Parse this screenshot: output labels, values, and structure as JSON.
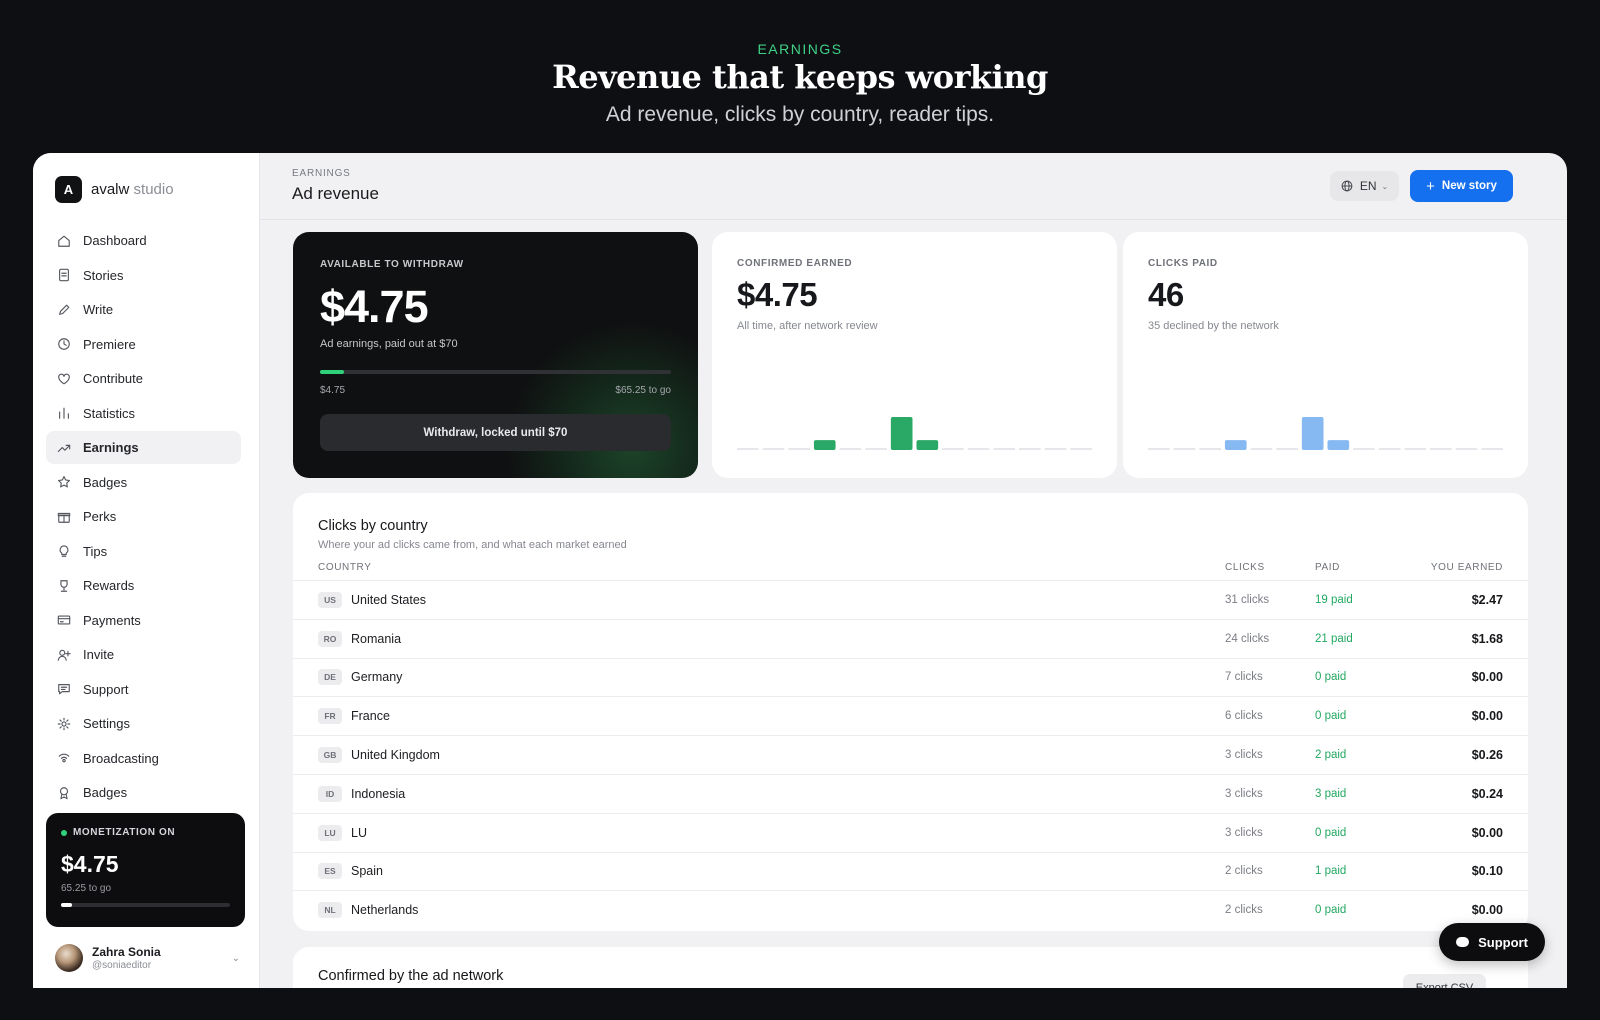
{
  "hero": {
    "kicker": "EARNINGS",
    "title": "Revenue that keeps working",
    "subtitle": "Ad revenue, clicks by country, reader tips."
  },
  "brand": {
    "mark": "A",
    "name": "avalw",
    "suffix": "studio"
  },
  "nav": [
    {
      "label": "Dashboard",
      "icon": "home-icon"
    },
    {
      "label": "Stories",
      "icon": "document-icon"
    },
    {
      "label": "Write",
      "icon": "pencil-icon"
    },
    {
      "label": "Premiere",
      "icon": "clock-icon"
    },
    {
      "label": "Contribute",
      "icon": "heart-icon"
    },
    {
      "label": "Statistics",
      "icon": "bar-chart-icon"
    },
    {
      "label": "Earnings",
      "icon": "trending-up-icon",
      "active": true
    },
    {
      "label": "Badges",
      "icon": "star-icon"
    },
    {
      "label": "Perks",
      "icon": "gift-icon"
    },
    {
      "label": "Tips",
      "icon": "lightbulb-icon"
    },
    {
      "label": "Rewards",
      "icon": "trophy-icon"
    },
    {
      "label": "Payments",
      "icon": "credit-card-icon"
    },
    {
      "label": "Invite",
      "icon": "user-plus-icon"
    },
    {
      "label": "Support",
      "icon": "message-icon"
    },
    {
      "label": "Settings",
      "icon": "gear-icon"
    },
    {
      "label": "Broadcasting",
      "icon": "broadcast-icon"
    },
    {
      "label": "Badges",
      "icon": "award-icon"
    }
  ],
  "monetization": {
    "label": "MONETIZATION ON",
    "amount": "$4.75",
    "sub": "65.25 to go",
    "progress": 0.068
  },
  "user": {
    "name": "Zahra Sonia",
    "handle": "@soniaeditor"
  },
  "header": {
    "crumb": "EARNINGS",
    "title": "Ad revenue",
    "lang": "EN",
    "new_story": "New story"
  },
  "withdraw_card": {
    "label": "AVAILABLE TO WITHDRAW",
    "amount": "$4.75",
    "sub": "Ad earnings, paid out at $70",
    "progress": 0.068,
    "bar_left": "$4.75",
    "bar_right": "$65.25 to go",
    "button": "Withdraw, locked until $70"
  },
  "confirmed_card": {
    "label": "CONFIRMED EARNED",
    "value": "$4.75",
    "sub": "All time, after network review",
    "color": "#2aa866",
    "bars": [
      0,
      0,
      0,
      0.3,
      0,
      0,
      1,
      0.3,
      0,
      0,
      0,
      0,
      0,
      0
    ]
  },
  "clicks_card": {
    "label": "CLICKS PAID",
    "value": "46",
    "sub": "35 declined by the network",
    "color": "#86b8f2",
    "bars": [
      0,
      0,
      0,
      0.3,
      0,
      0,
      1,
      0.3,
      0,
      0,
      0,
      0,
      0,
      0
    ]
  },
  "countries": {
    "title": "Clicks by country",
    "subtitle": "Where your ad clicks came from, and what each market earned",
    "headers": {
      "country": "COUNTRY",
      "clicks": "CLICKS",
      "paid": "PAID",
      "earned": "YOU EARNED"
    },
    "rows": [
      {
        "code": "US",
        "name": "United States",
        "clicks": "31 clicks",
        "paid": "19 paid",
        "earned": "$2.47"
      },
      {
        "code": "RO",
        "name": "Romania",
        "clicks": "24 clicks",
        "paid": "21 paid",
        "earned": "$1.68"
      },
      {
        "code": "DE",
        "name": "Germany",
        "clicks": "7 clicks",
        "paid": "0 paid",
        "earned": "$0.00"
      },
      {
        "code": "FR",
        "name": "France",
        "clicks": "6 clicks",
        "paid": "0 paid",
        "earned": "$0.00"
      },
      {
        "code": "GB",
        "name": "United Kingdom",
        "clicks": "3 clicks",
        "paid": "2 paid",
        "earned": "$0.26"
      },
      {
        "code": "ID",
        "name": "Indonesia",
        "clicks": "3 clicks",
        "paid": "3 paid",
        "earned": "$0.24"
      },
      {
        "code": "LU",
        "name": "LU",
        "clicks": "3 clicks",
        "paid": "0 paid",
        "earned": "$0.00"
      },
      {
        "code": "ES",
        "name": "Spain",
        "clicks": "2 clicks",
        "paid": "1 paid",
        "earned": "$0.10"
      },
      {
        "code": "NL",
        "name": "Netherlands",
        "clicks": "2 clicks",
        "paid": "0 paid",
        "earned": "$0.00"
      }
    ]
  },
  "confirmed_section": {
    "title": "Confirmed by the ad network",
    "export": "Export CSV"
  },
  "support_button": "Support"
}
